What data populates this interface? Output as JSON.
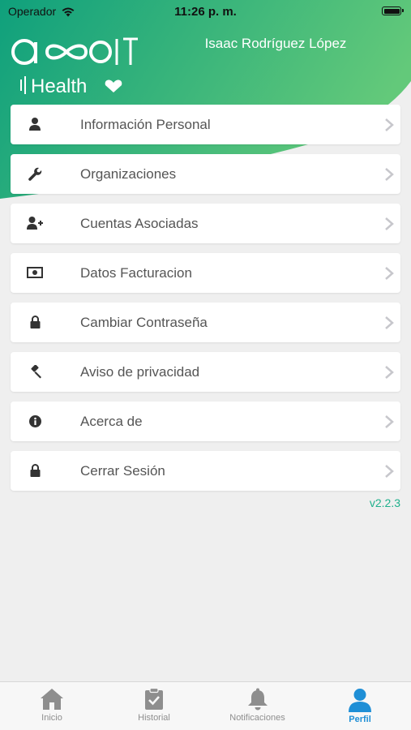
{
  "status_bar": {
    "carrier": "Operador",
    "time": "11:26 p. m."
  },
  "header": {
    "logo_text": "axoIT",
    "logo_subtext": "Health",
    "user_name": "Isaac Rodríguez López"
  },
  "menu": {
    "items": [
      {
        "label": "Información Personal",
        "icon": "user-icon"
      },
      {
        "label": "Organizaciones",
        "icon": "wrench-icon"
      },
      {
        "label": "Cuentas Asociadas",
        "icon": "user-plus-icon"
      },
      {
        "label": "Datos Facturacion",
        "icon": "money-icon"
      },
      {
        "label": "Cambiar Contraseña",
        "icon": "lock-icon"
      },
      {
        "label": "Aviso de privacidad",
        "icon": "gavel-icon"
      },
      {
        "label": "Acerca de",
        "icon": "info-icon"
      },
      {
        "label": "Cerrar Sesión",
        "icon": "lock-icon"
      }
    ]
  },
  "version": "v2.2.3",
  "tabbar": {
    "tabs": [
      {
        "label": "Inicio",
        "icon": "home-icon",
        "active": false
      },
      {
        "label": "Historial",
        "icon": "clipboard-check-icon",
        "active": false
      },
      {
        "label": "Notificaciones",
        "icon": "bell-icon",
        "active": false
      },
      {
        "label": "Perfil",
        "icon": "person-icon",
        "active": true
      }
    ]
  },
  "colors": {
    "gradient_start": "#13a37d",
    "gradient_end": "#5bc87a",
    "accent": "#1f8fd6",
    "version_text": "#1fb08c"
  }
}
